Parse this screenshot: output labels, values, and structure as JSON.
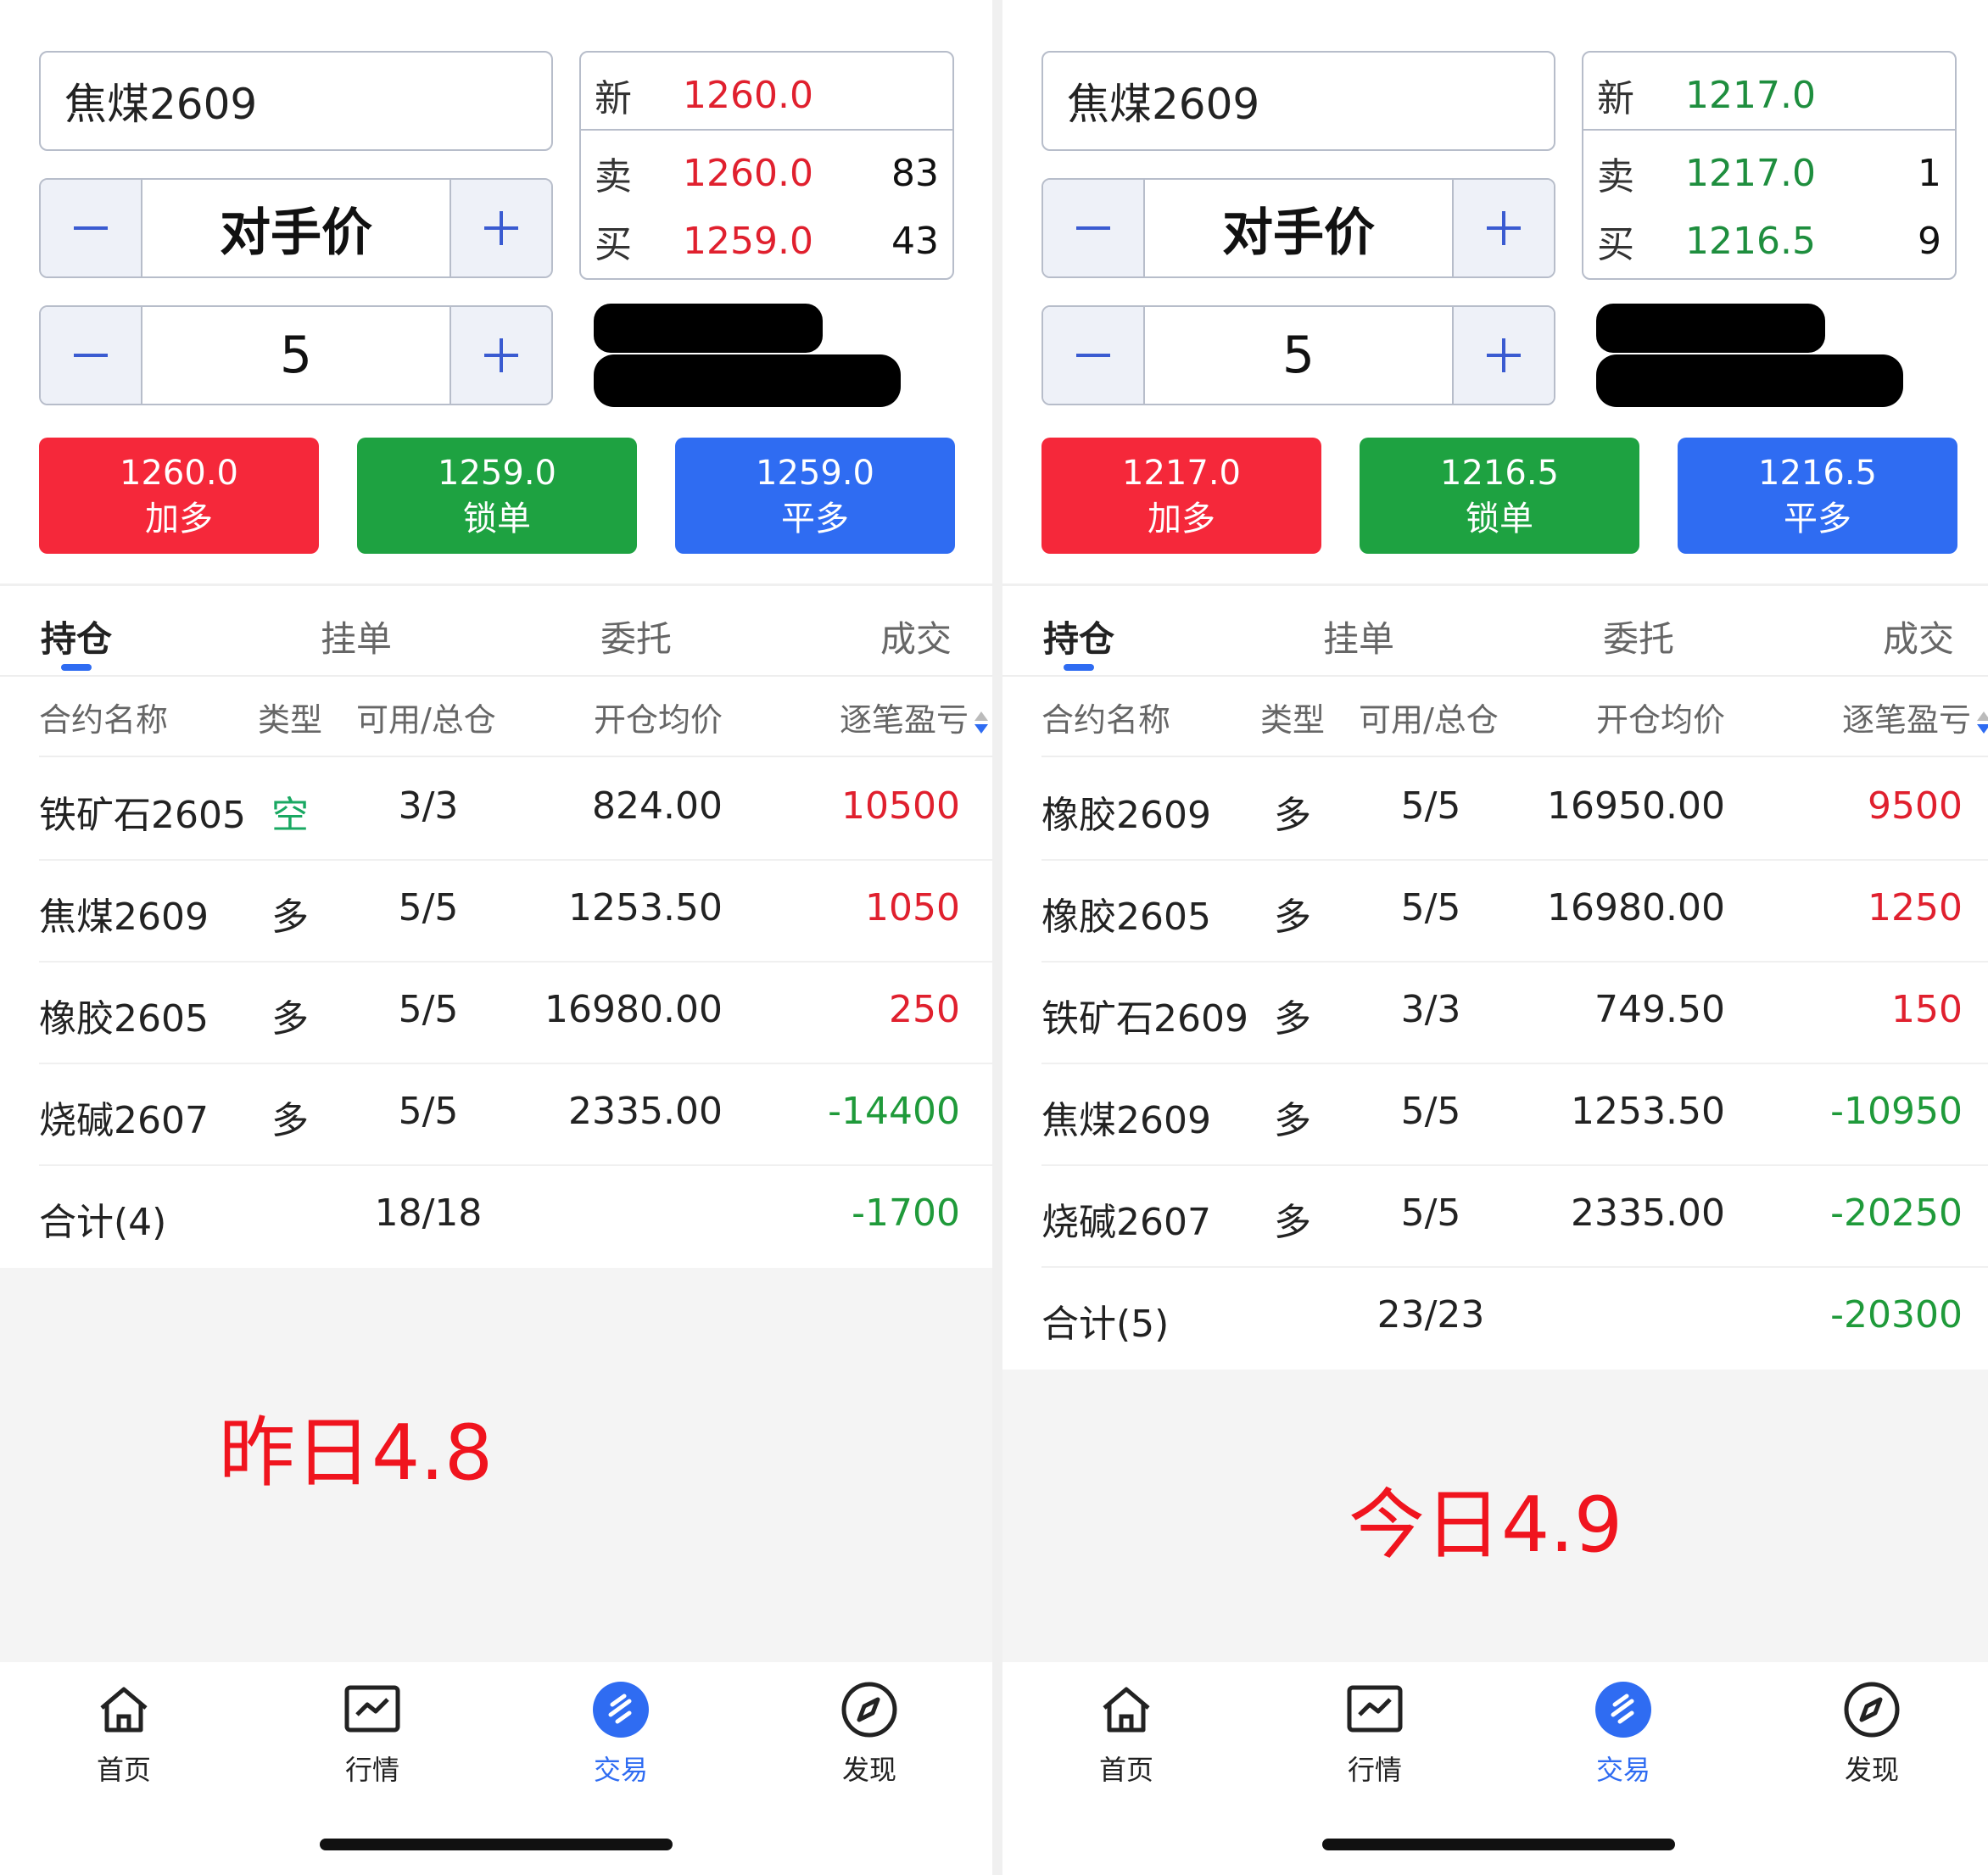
{
  "screens": [
    {
      "contract": "焦煤2609",
      "price_mode": "对手价",
      "quantity": "5",
      "quote": {
        "new_label": "新",
        "new_price": "1260.0",
        "sell_label": "卖",
        "sell_price": "1260.0",
        "sell_vol": "83",
        "buy_label": "买",
        "buy_price": "1259.0",
        "buy_vol": "43",
        "color": "#e0202e"
      },
      "actions": [
        {
          "price": "1260.0",
          "label": "加多"
        },
        {
          "price": "1259.0",
          "label": "锁单"
        },
        {
          "price": "1259.0",
          "label": "平多"
        }
      ],
      "tabs": [
        "持仓",
        "挂单",
        "委托",
        "成交"
      ],
      "columns": [
        "合约名称",
        "类型",
        "可用/总仓",
        "开仓均价",
        "逐笔盈亏"
      ],
      "rows": [
        {
          "name": "铁矿石2605",
          "type": "空",
          "qty": "3/3",
          "avg": "824.00",
          "pnl": "10500",
          "pnl_sign": "pos"
        },
        {
          "name": "焦煤2609",
          "type": "多",
          "qty": "5/5",
          "avg": "1253.50",
          "pnl": "1050",
          "pnl_sign": "pos"
        },
        {
          "name": "橡胶2605",
          "type": "多",
          "qty": "5/5",
          "avg": "16980.00",
          "pnl": "250",
          "pnl_sign": "pos"
        },
        {
          "name": "烧碱2607",
          "type": "多",
          "qty": "5/5",
          "avg": "2335.00",
          "pnl": "-14400",
          "pnl_sign": "neg"
        }
      ],
      "total": {
        "label": "合计(4)",
        "qty": "18/18",
        "pnl": "-1700"
      },
      "annotation": "昨日4.8"
    },
    {
      "contract": "焦煤2609",
      "price_mode": "对手价",
      "quantity": "5",
      "quote": {
        "new_label": "新",
        "new_price": "1217.0",
        "sell_label": "卖",
        "sell_price": "1217.0",
        "sell_vol": "1",
        "buy_label": "买",
        "buy_price": "1216.5",
        "buy_vol": "9",
        "color": "#1e8e3e"
      },
      "actions": [
        {
          "price": "1217.0",
          "label": "加多"
        },
        {
          "price": "1216.5",
          "label": "锁单"
        },
        {
          "price": "1216.5",
          "label": "平多"
        }
      ],
      "tabs": [
        "持仓",
        "挂单",
        "委托",
        "成交"
      ],
      "columns": [
        "合约名称",
        "类型",
        "可用/总仓",
        "开仓均价",
        "逐笔盈亏"
      ],
      "rows": [
        {
          "name": "橡胶2609",
          "type": "多",
          "qty": "5/5",
          "avg": "16950.00",
          "pnl": "9500",
          "pnl_sign": "pos"
        },
        {
          "name": "橡胶2605",
          "type": "多",
          "qty": "5/5",
          "avg": "16980.00",
          "pnl": "1250",
          "pnl_sign": "pos"
        },
        {
          "name": "铁矿石2609",
          "type": "多",
          "qty": "3/3",
          "avg": "749.50",
          "pnl": "150",
          "pnl_sign": "pos"
        },
        {
          "name": "焦煤2609",
          "type": "多",
          "qty": "5/5",
          "avg": "1253.50",
          "pnl": "-10950",
          "pnl_sign": "neg"
        },
        {
          "name": "烧碱2607",
          "type": "多",
          "qty": "5/5",
          "avg": "2335.00",
          "pnl": "-20250",
          "pnl_sign": "neg"
        }
      ],
      "total": {
        "label": "合计(5)",
        "qty": "23/23",
        "pnl": "-20300"
      },
      "annotation": "今日4.9"
    }
  ],
  "nav": [
    {
      "label": "首页",
      "icon": "home-icon"
    },
    {
      "label": "行情",
      "icon": "chart-icon"
    },
    {
      "label": "交易",
      "icon": "trade-icon"
    },
    {
      "label": "发现",
      "icon": "compass-icon"
    }
  ],
  "colors": {
    "accent": "#2f6cf2",
    "up": "#e0202e",
    "down": "#1f9a3a"
  }
}
